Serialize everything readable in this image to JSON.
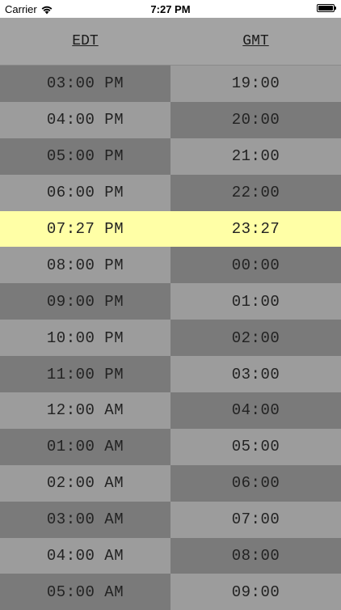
{
  "status_bar": {
    "carrier": "Carrier",
    "time": "7:27 PM",
    "wifi_icon": "wifi-icon",
    "battery_icon": "battery-icon"
  },
  "header": {
    "left": "EDT",
    "right": "GMT"
  },
  "colors": {
    "dark": "#7a7a7a",
    "light": "#9c9c9c",
    "highlight": "#ffffa6"
  },
  "rows": [
    {
      "left": "03:00 PM",
      "right": "19:00"
    },
    {
      "left": "04:00 PM",
      "right": "20:00"
    },
    {
      "left": "05:00 PM",
      "right": "21:00"
    },
    {
      "left": "06:00 PM",
      "right": "22:00"
    },
    {
      "left": "07:27 PM",
      "right": "23:27"
    },
    {
      "left": "08:00 PM",
      "right": "00:00"
    },
    {
      "left": "09:00 PM",
      "right": "01:00"
    },
    {
      "left": "10:00 PM",
      "right": "02:00"
    },
    {
      "left": "11:00 PM",
      "right": "03:00"
    },
    {
      "left": "12:00 AM",
      "right": "04:00"
    },
    {
      "left": "01:00 AM",
      "right": "05:00"
    },
    {
      "left": "02:00 AM",
      "right": "06:00"
    },
    {
      "left": "03:00 AM",
      "right": "07:00"
    },
    {
      "left": "04:00 AM",
      "right": "08:00"
    },
    {
      "left": "05:00 AM",
      "right": "09:00"
    }
  ]
}
